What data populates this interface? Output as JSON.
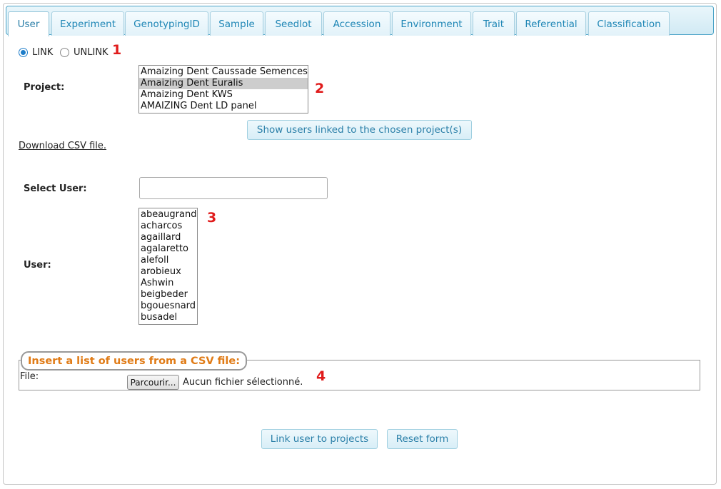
{
  "tabs": [
    {
      "label": "User",
      "active": true
    },
    {
      "label": "Experiment"
    },
    {
      "label": "GenotypingID"
    },
    {
      "label": "Sample"
    },
    {
      "label": "Seedlot"
    },
    {
      "label": "Accession"
    },
    {
      "label": "Environment"
    },
    {
      "label": "Trait"
    },
    {
      "label": "Referential"
    },
    {
      "label": "Classification"
    }
  ],
  "mode": {
    "link_label": "LINK",
    "unlink_label": "UNLINK",
    "selected": "LINK"
  },
  "annotations": [
    "1",
    "2",
    "3",
    "4"
  ],
  "project": {
    "label": "Project:",
    "options": [
      "Amaizing Dent Caussade Semences",
      "Amaizing Dent Euralis",
      "Amaizing Dent KWS",
      "AMAIZING Dent LD panel"
    ],
    "selected_index": 1
  },
  "show_users_button": "Show users linked to the chosen project(s)",
  "download_link": "Download CSV file.",
  "select_user": {
    "label": "Select User:",
    "value": ""
  },
  "user": {
    "label": "User:",
    "options": [
      "abeaugrand",
      "acharcos",
      "agaillard",
      "agalaretto",
      "alefoll",
      "arobieux",
      "Ashwin",
      "beigbeder",
      "bgouesnard",
      "busadel"
    ]
  },
  "csv_section": {
    "legend": "Insert a list of users from a CSV file:",
    "file_label": "File:",
    "browse_label": "Parcourir...",
    "no_file_text": "Aucun fichier sélectionné."
  },
  "actions": {
    "link_button": "Link user to projects",
    "reset_button": "Reset form"
  },
  "colors": {
    "tab_text": "#1e86b5",
    "legend_text": "#e07b16",
    "annotation": "#e01b1b",
    "radio_checked": "#1e7dc9"
  }
}
